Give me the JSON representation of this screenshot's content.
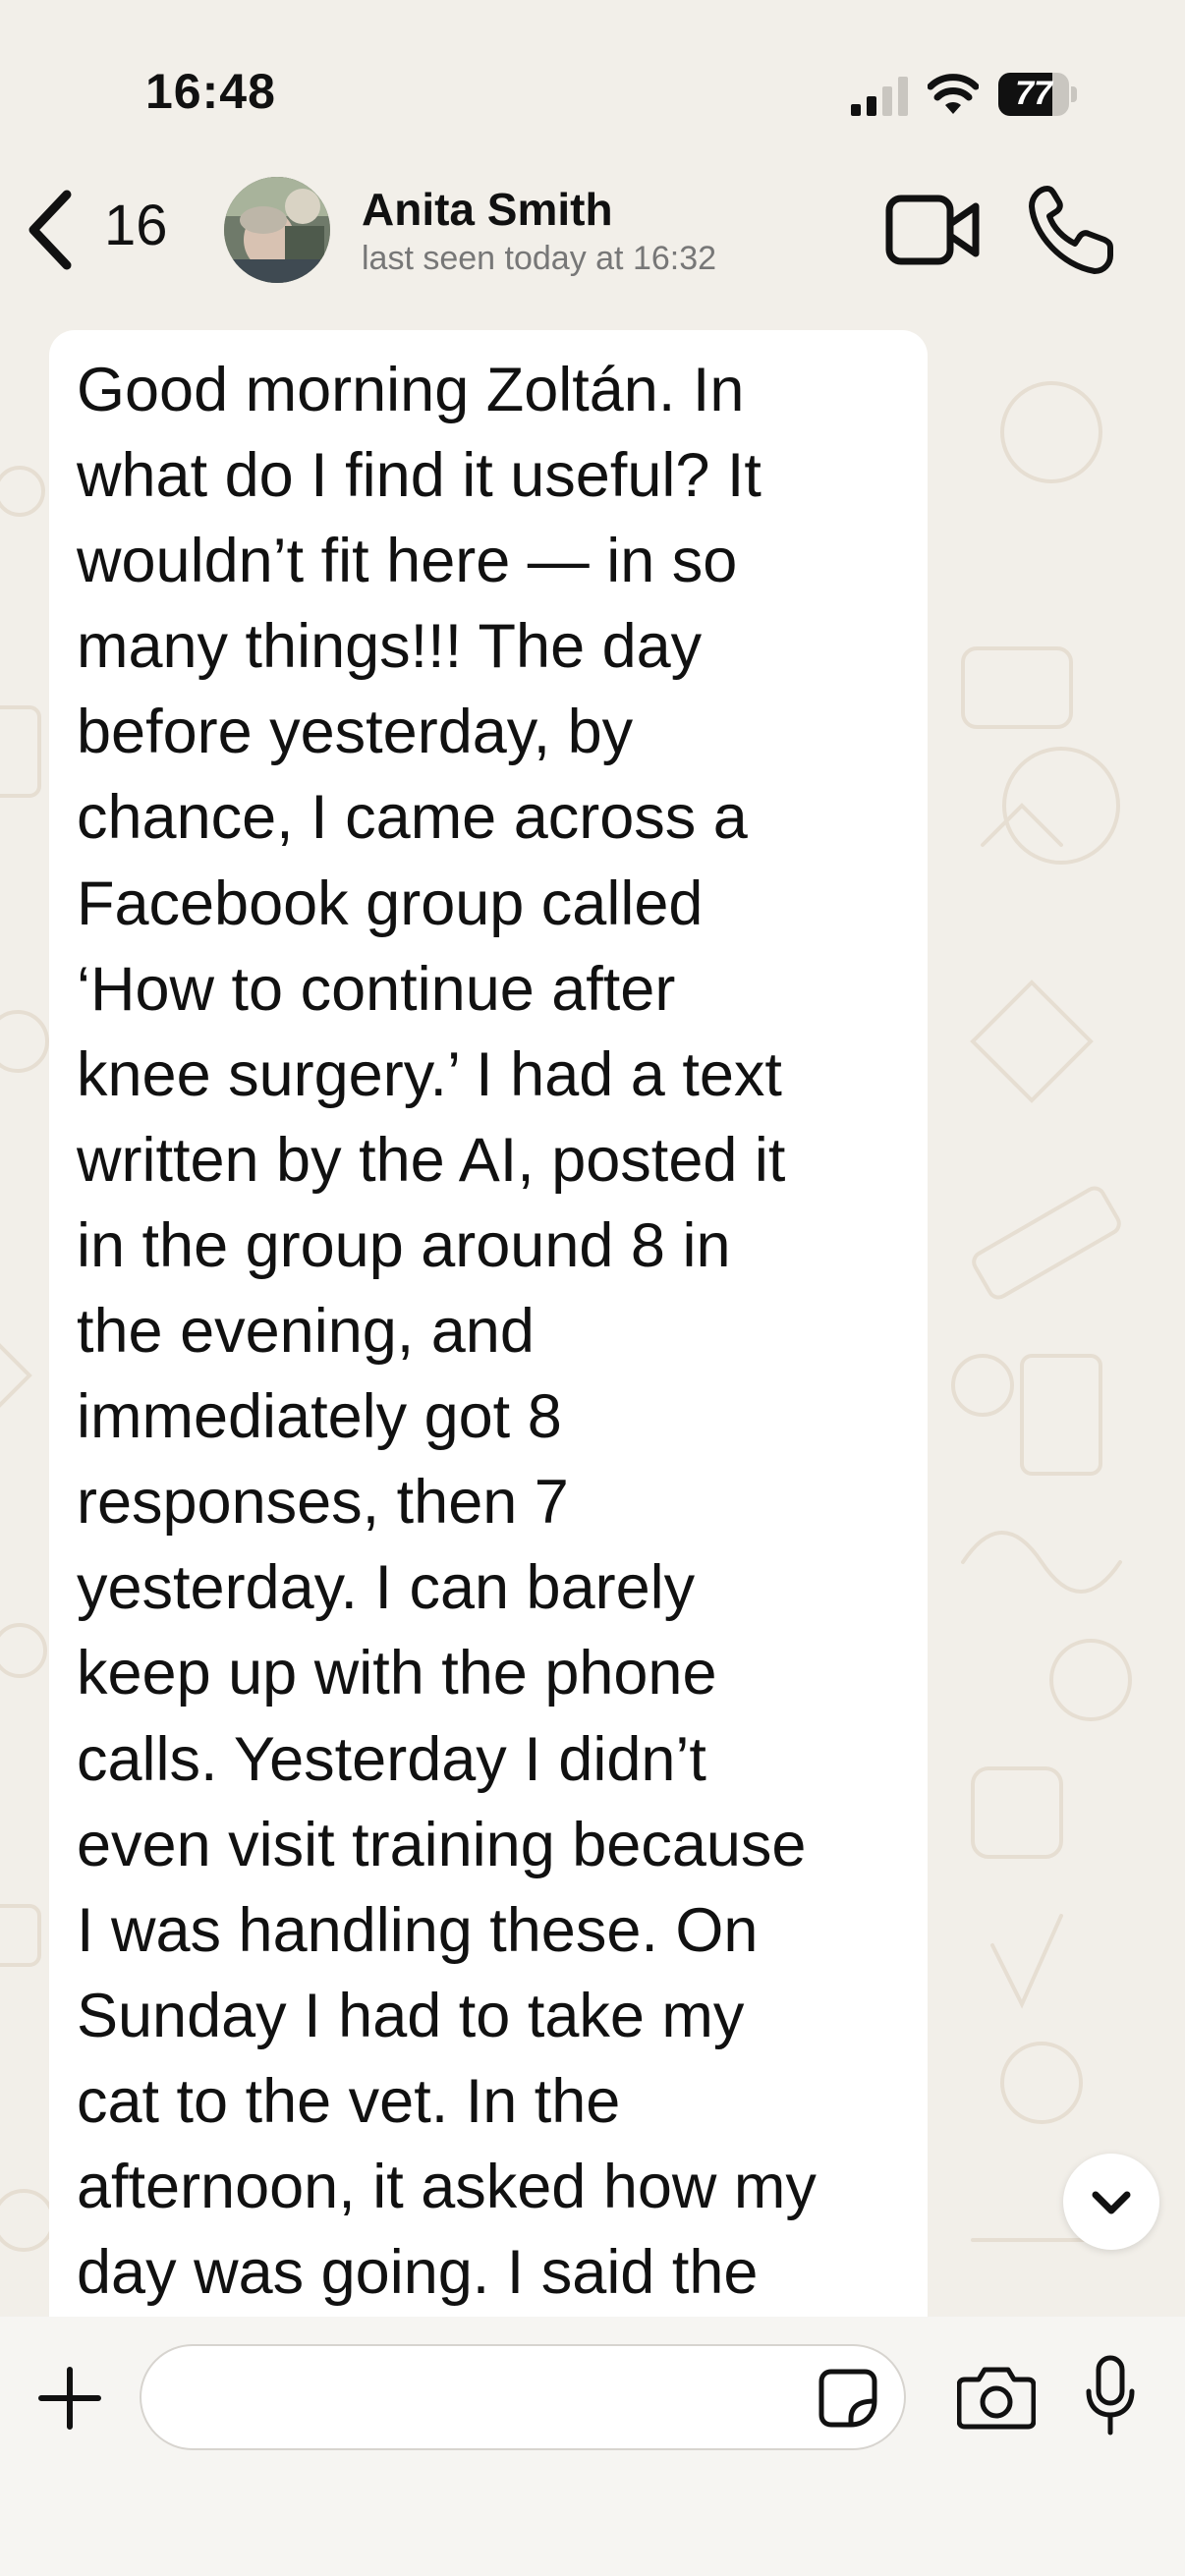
{
  "status_bar": {
    "time": "16:48",
    "battery_level": "77",
    "signal_bars_active": 2,
    "signal_bars_total": 4
  },
  "header": {
    "back_count": "16",
    "contact_name": "Anita Smith",
    "contact_status": "last seen today at 16:32"
  },
  "message": {
    "text": "Good morning Zoltán. In\nwhat do I find it useful? It\nwouldn’t fit here — in so\nmany things!!! The day\nbefore yesterday, by\nchance, I came across a\nFacebook group called\n‘How to continue after\nknee surgery.’ I had a text\nwritten by the AI, posted it\nin the group around 8 in\nthe evening, and\nimmediately got 8\nresponses, then 7\nyesterday. I can barely\nkeep up with the phone\ncalls. Yesterday I didn’t\neven visit training because\nI was handling these. On\nSunday I had to take my\ncat to the vet. In the\nafternoon, it asked how my\nday was going. I said the"
  },
  "composer": {
    "placeholder": ""
  },
  "colors": {
    "background": "#f2efe9",
    "bubble": "#ffffff",
    "icon": "#111111",
    "wallpaper_doodle": "#e6ded2"
  }
}
